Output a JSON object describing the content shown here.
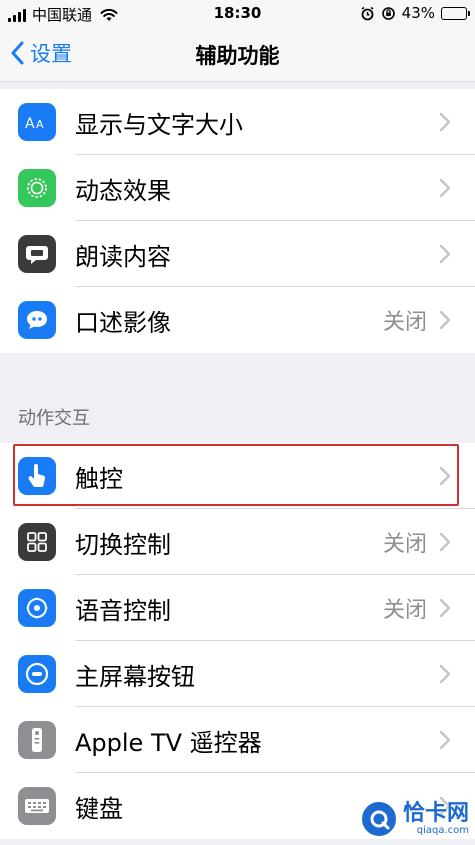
{
  "status_bar": {
    "carrier": "中国联通",
    "time": "18:30",
    "battery_percent": "43%",
    "battery_level": 0.43
  },
  "nav": {
    "back_label": "设置",
    "title": "辅助功能"
  },
  "vision_items": [
    {
      "label": "显示与文字大小",
      "value": "",
      "icon": "text-size-icon",
      "color": "#1a7cf5"
    },
    {
      "label": "动态效果",
      "value": "",
      "icon": "motion-icon",
      "color": "#34c759"
    },
    {
      "label": "朗读内容",
      "value": "",
      "icon": "spoken-content-icon",
      "color": "#3a3a3c"
    },
    {
      "label": "口述影像",
      "value": "关闭",
      "icon": "audio-description-icon",
      "color": "#1a7cf5"
    }
  ],
  "section_header": "动作交互",
  "interaction_items": [
    {
      "label": "触控",
      "value": "",
      "icon": "touch-icon",
      "color": "#1a7cf5"
    },
    {
      "label": "切换控制",
      "value": "关闭",
      "icon": "switch-control-icon",
      "color": "#3a3a3c"
    },
    {
      "label": "语音控制",
      "value": "关闭",
      "icon": "voice-control-icon",
      "color": "#1a7cf5"
    },
    {
      "label": "主屏幕按钮",
      "value": "",
      "icon": "home-button-icon",
      "color": "#1a7cf5"
    },
    {
      "label": "Apple TV 遥控器",
      "value": "",
      "icon": "apple-tv-remote-icon",
      "color": "#8e8e93"
    },
    {
      "label": "键盘",
      "value": "",
      "icon": "keyboard-icon",
      "color": "#8e8e93"
    }
  ],
  "watermark": {
    "text": "恰卡网",
    "url": "qiaqa.com"
  }
}
